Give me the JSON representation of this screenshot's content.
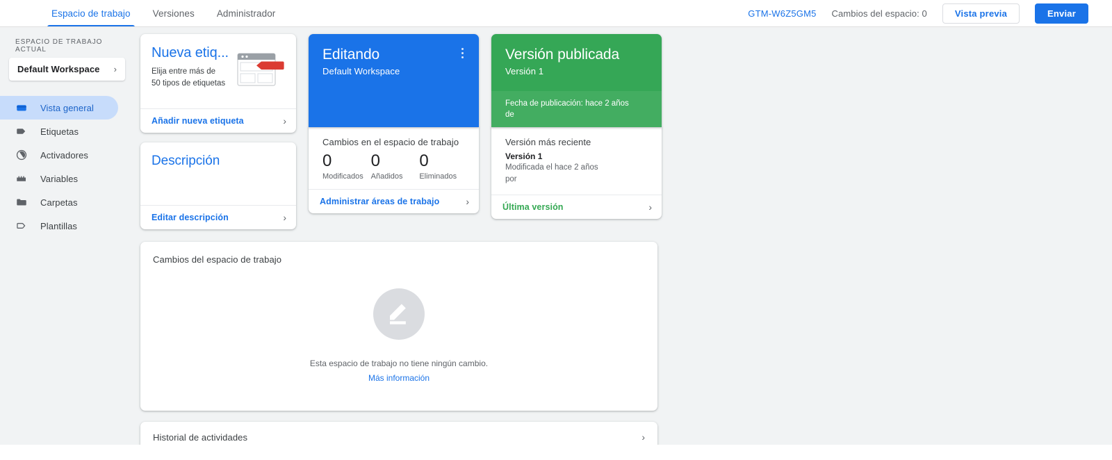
{
  "topbar": {
    "nav": [
      {
        "label": "Espacio de trabajo",
        "active": true
      },
      {
        "label": "Versiones",
        "active": false
      },
      {
        "label": "Administrador",
        "active": false
      }
    ],
    "container_id": "GTM-W6Z5GM5",
    "workspace_changes": "Cambios del espacio: 0",
    "preview_label": "Vista previa",
    "submit_label": "Enviar",
    "accent_color": "#1a73e8"
  },
  "sidebar": {
    "section_label": "ESPACIO DE TRABAJO ACTUAL",
    "workspace_name": "Default Workspace",
    "workspace_chevron": "›",
    "items": [
      {
        "label": "Vista general",
        "icon": "container-icon",
        "active": true
      },
      {
        "label": "Etiquetas",
        "icon": "tag-icon",
        "active": false
      },
      {
        "label": "Activadores",
        "icon": "trigger-icon",
        "active": false
      },
      {
        "label": "Variables",
        "icon": "variables-icon",
        "active": false
      },
      {
        "label": "Carpetas",
        "icon": "folder-icon",
        "active": false
      },
      {
        "label": "Plantillas",
        "icon": "template-icon",
        "active": false
      }
    ]
  },
  "new_tag_card": {
    "title": "Nueva etiq...",
    "subtitle_line1": "Elija entre más de",
    "subtitle_line2": "50 tipos de etiquetas",
    "action_label": "Añadir nueva etiqueta",
    "chevron": "›",
    "illustration": "browser-window-with-red-tag",
    "tag_color": "#db3b32"
  },
  "description_card": {
    "title": "Descripción",
    "action_label": "Editar descripción",
    "chevron": "›"
  },
  "editing_card": {
    "title": "Editando",
    "subtitle": "Default Workspace",
    "menu_icon": "kebab-menu-icon",
    "background_color": "#1a73e8"
  },
  "workspace_changes_card": {
    "title": "Cambios en el espacio de trabajo",
    "stats": [
      {
        "value": "0",
        "label": "Modificados"
      },
      {
        "value": "0",
        "label": "Añadidos"
      },
      {
        "value": "0",
        "label": "Eliminados"
      }
    ],
    "action_label": "Administrar áreas de trabajo",
    "chevron": "›"
  },
  "published_card": {
    "title": "Versión publicada",
    "subtitle": "Versión 1",
    "meta_line1": "Fecha de publicación: hace 2 años",
    "meta_line2": "de",
    "background_color": "#35a756"
  },
  "latest_version_card": {
    "title": "Versión más reciente",
    "version_name": "Versión 1",
    "meta_line1": "Modificada el hace 2 años",
    "meta_line2": "por",
    "action_label": "Última versión",
    "chevron": "›"
  },
  "changes_panel": {
    "title": "Cambios del espacio de trabajo",
    "empty_icon": "pencil-edit-icon",
    "empty_text": "Esta espacio de trabajo no tiene ningún cambio.",
    "empty_link": "Más información"
  },
  "activity_panel": {
    "title": "Historial de actividades",
    "chevron": "›"
  }
}
